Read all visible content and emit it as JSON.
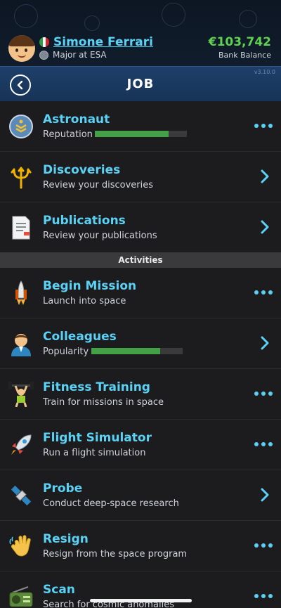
{
  "header": {
    "name": "Simone Ferrari",
    "job_title": "Major at ESA",
    "balance": "€103,742",
    "balance_label": "Bank Balance",
    "flag_colors": [
      "#2e9f44",
      "#ffffff",
      "#d8262f"
    ]
  },
  "title_bar": {
    "title": "JOB",
    "version": "v3.10.0"
  },
  "job_items": [
    {
      "title": "Astronaut",
      "subtitle": "Reputation",
      "meter": 0.8,
      "icon": "astronaut-rank-badge-icon",
      "action": "more"
    },
    {
      "title": "Discoveries",
      "subtitle": "Review your discoveries",
      "icon": "trident-icon",
      "action": "chevron"
    },
    {
      "title": "Publications",
      "subtitle": "Review your publications",
      "icon": "document-icon",
      "action": "chevron"
    }
  ],
  "section_label": "Activities",
  "activity_items": [
    {
      "title": "Begin Mission",
      "subtitle": "Launch into space",
      "icon": "space-shuttle-icon",
      "action": "more"
    },
    {
      "title": "Colleagues",
      "subtitle": "Popularity",
      "meter": 0.75,
      "icon": "man-icon",
      "action": "chevron"
    },
    {
      "title": "Fitness Training",
      "subtitle": "Train for missions in space",
      "icon": "weightlifter-icon",
      "action": "more"
    },
    {
      "title": "Flight Simulator",
      "subtitle": "Run a flight simulation",
      "icon": "rocket-icon",
      "action": "more"
    },
    {
      "title": "Probe",
      "subtitle": "Conduct deep-space research",
      "icon": "satellite-icon",
      "action": "chevron"
    },
    {
      "title": "Resign",
      "subtitle": "Resign from the space program",
      "icon": "waving-hand-icon",
      "action": "more"
    },
    {
      "title": "Scan",
      "subtitle": "Search for cosmic anomalies",
      "icon": "radio-icon",
      "action": "more"
    }
  ],
  "colors": {
    "accent": "#5ad2f5",
    "money": "#5fd24f",
    "meter": "#43a047",
    "background": "#1c1c1e",
    "title_bar": "#1e3f6a"
  }
}
